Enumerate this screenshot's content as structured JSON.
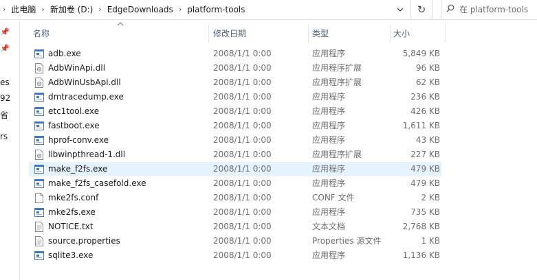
{
  "address": {
    "crumbs": [
      "此电脑",
      "新加卷 (D:)",
      "EdgeDownloads",
      "platform-tools"
    ]
  },
  "search": {
    "placeholder": "在 platform-tools"
  },
  "nav": {
    "fragments": [
      "es",
      "92",
      "省",
      "rs"
    ]
  },
  "columns": {
    "name": "名称",
    "date": "修改日期",
    "type": "类型",
    "size": "大小"
  },
  "files": [
    {
      "name": "adb.exe",
      "date": "2008/1/1 0:00",
      "type": "应用程序",
      "size": "5,849 KB",
      "icon": "app-icon"
    },
    {
      "name": "AdbWinApi.dll",
      "date": "2008/1/1 0:00",
      "type": "应用程序扩展",
      "size": "96 KB",
      "icon": "dll-icon"
    },
    {
      "name": "AdbWinUsbApi.dll",
      "date": "2008/1/1 0:00",
      "type": "应用程序扩展",
      "size": "62 KB",
      "icon": "dll-icon"
    },
    {
      "name": "dmtracedump.exe",
      "date": "2008/1/1 0:00",
      "type": "应用程序",
      "size": "236 KB",
      "icon": "app-icon"
    },
    {
      "name": "etc1tool.exe",
      "date": "2008/1/1 0:00",
      "type": "应用程序",
      "size": "426 KB",
      "icon": "app-icon"
    },
    {
      "name": "fastboot.exe",
      "date": "2008/1/1 0:00",
      "type": "应用程序",
      "size": "1,611 KB",
      "icon": "app-icon"
    },
    {
      "name": "hprof-conv.exe",
      "date": "2008/1/1 0:00",
      "type": "应用程序",
      "size": "43 KB",
      "icon": "app-icon"
    },
    {
      "name": "libwinpthread-1.dll",
      "date": "2008/1/1 0:00",
      "type": "应用程序扩展",
      "size": "227 KB",
      "icon": "dll-icon"
    },
    {
      "name": "make_f2fs.exe",
      "date": "2008/1/1 0:00",
      "type": "应用程序",
      "size": "479 KB",
      "icon": "app-icon",
      "selected": true
    },
    {
      "name": "make_f2fs_casefold.exe",
      "date": "2008/1/1 0:00",
      "type": "应用程序",
      "size": "479 KB",
      "icon": "app-icon"
    },
    {
      "name": "mke2fs.conf",
      "date": "2008/1/1 0:00",
      "type": "CONF 文件",
      "size": "2 KB",
      "icon": "file-icon"
    },
    {
      "name": "mke2fs.exe",
      "date": "2008/1/1 0:00",
      "type": "应用程序",
      "size": "735 KB",
      "icon": "app-icon"
    },
    {
      "name": "NOTICE.txt",
      "date": "2008/1/1 0:00",
      "type": "文本文档",
      "size": "2,768 KB",
      "icon": "text-file-icon"
    },
    {
      "name": "source.properties",
      "date": "2008/1/1 0:00",
      "type": "Properties 源文件",
      "size": "1 KB",
      "icon": "text-file-icon"
    },
    {
      "name": "sqlite3.exe",
      "date": "2008/1/1 0:00",
      "type": "应用程序",
      "size": "1,136 KB",
      "icon": "app-icon"
    }
  ]
}
